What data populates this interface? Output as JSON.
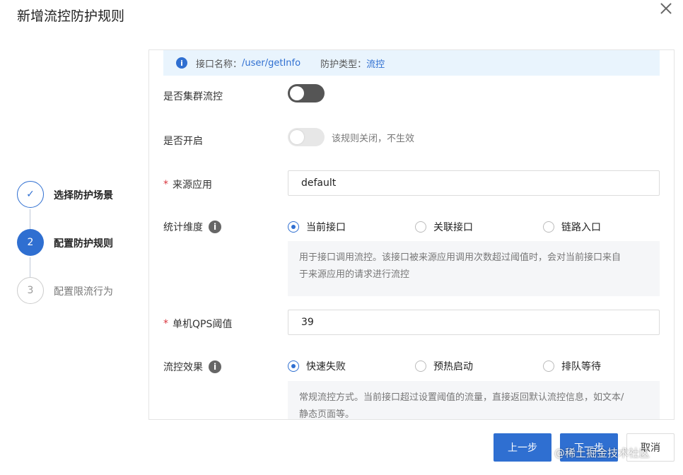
{
  "dialog": {
    "title": "新增流控防护规则",
    "close_icon": "close-icon"
  },
  "steps": [
    {
      "number": "✓",
      "label": "选择防护场景",
      "state": "done"
    },
    {
      "number": "2",
      "label": "配置防护规则",
      "state": "active"
    },
    {
      "number": "3",
      "label": "配置限流行为",
      "state": "pending"
    }
  ],
  "info_bar": {
    "icon": "info-icon",
    "api_label": "接口名称：",
    "api_value": "/user/getInfo",
    "type_label": "防护类型：",
    "type_value": "流控"
  },
  "form": {
    "cluster": {
      "label": "是否集群流控",
      "value": "off"
    },
    "enable": {
      "label": "是否开启",
      "value": "off",
      "hint": "该规则关闭，不生效"
    },
    "source": {
      "label": "来源应用",
      "required": "*",
      "value": "default"
    },
    "dimension": {
      "label": "统计维度",
      "options": [
        "当前接口",
        "关联接口",
        "链路入口"
      ],
      "selected": "当前接口",
      "desc_line1": "用于接口调用流控。该接口被来源应用调用次数超过阈值时，会对当前接口来自",
      "desc_line2": "于来源应用的请求进行流控"
    },
    "qps": {
      "label": "单机QPS阈值",
      "required": "*",
      "value": "39"
    },
    "effect": {
      "label": "流控效果",
      "options": [
        "快速失败",
        "预热启动",
        "排队等待"
      ],
      "selected": "快速失败",
      "desc_line1": "常规流控方式。当前接口超过设置阈值的流量，直接返回默认流控信息，如文本/",
      "desc_line2": "静态页面等。"
    }
  },
  "buttons": {
    "prev": "上一步",
    "next": "下一步",
    "cancel": "取消"
  },
  "watermark": "@稀土掘金技术社区",
  "colors": {
    "primary": "#2f6fd1",
    "info_bg": "#e9f4fd"
  }
}
